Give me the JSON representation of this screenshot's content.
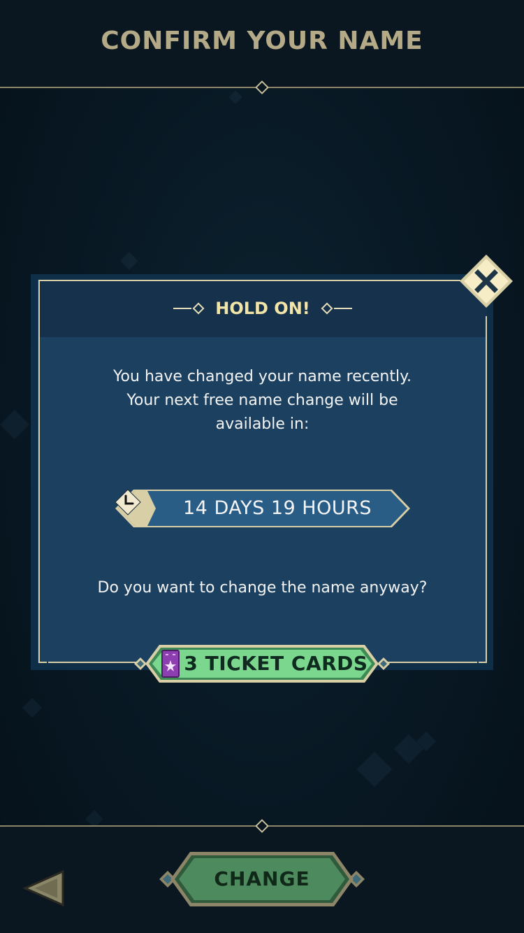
{
  "header": {
    "title": "CONFIRM YOUR NAME"
  },
  "dialog": {
    "title": "HOLD ON!",
    "message_lines": [
      "You have changed your name recently.",
      "Your next free name change will be",
      "available in:"
    ],
    "timer": "14 DAYS 19 HOURS",
    "question": "Do you want to change the name anyway?",
    "ticket_button": "3 TICKET CARDS"
  },
  "footer": {
    "change_button": "CHANGE"
  },
  "icons": {
    "close": "close-icon",
    "clock": "clock-icon",
    "ticket": "ticket-icon",
    "back": "back-arrow-icon"
  },
  "colors": {
    "gold": "#d8cfa6",
    "title_gold": "#f3e4a8",
    "panel": "#1c4160",
    "green": "#7bd68e"
  }
}
